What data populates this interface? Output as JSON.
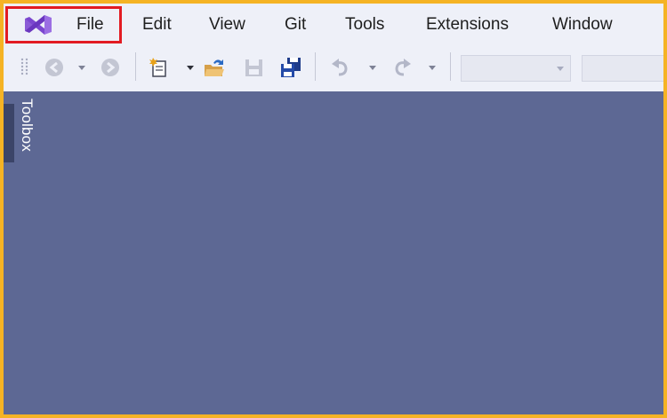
{
  "menubar": {
    "items": [
      "File",
      "Edit",
      "View",
      "Git",
      "Tools",
      "Extensions",
      "Window"
    ]
  },
  "toolbar": {
    "icons": [
      "grip",
      "back-arrow",
      "dropdown",
      "forward-arrow",
      "new-project",
      "dropdown",
      "open-folder",
      "save",
      "save-all",
      "undo",
      "dropdown",
      "redo",
      "dropdown"
    ],
    "config_combo_value": "",
    "platform_combo_value": ""
  },
  "toolbox": {
    "label": "Toolbox"
  },
  "colors": {
    "frame_border": "#f5b324",
    "workspace": "#5d6894",
    "chrome": "#eef0f8",
    "highlight": "#e21b22",
    "vs_logo": "#7b46cf"
  }
}
